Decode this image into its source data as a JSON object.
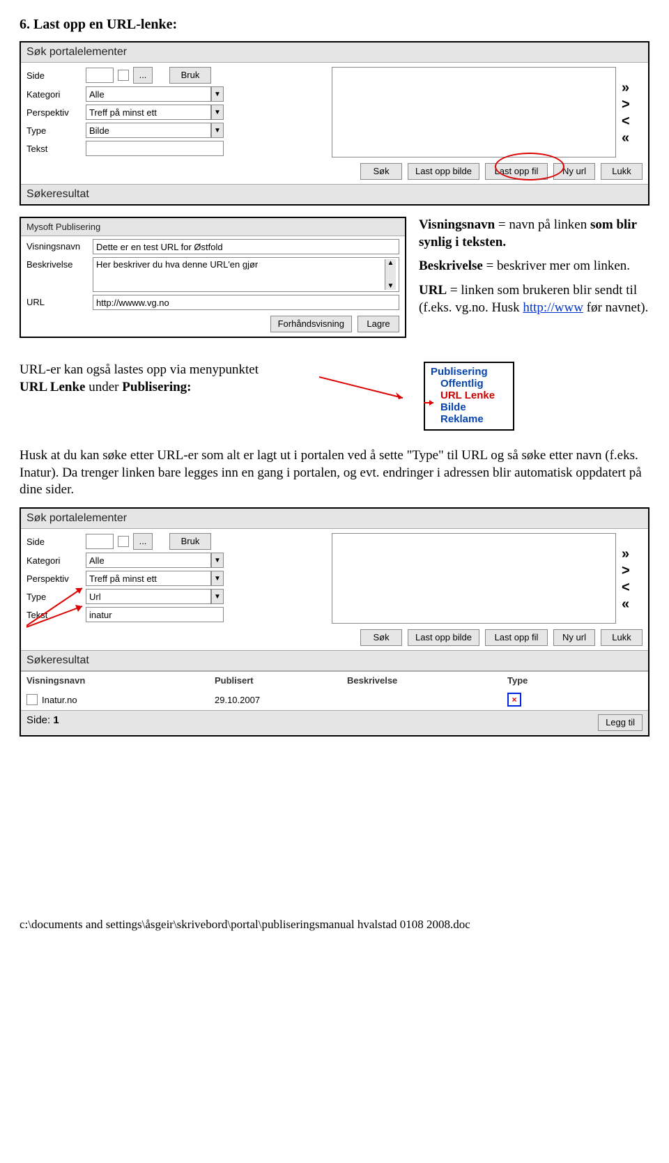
{
  "heading": "6. Last opp en URL-lenke:",
  "panel1": {
    "title": "Søk portalelementer",
    "labels": {
      "side": "Side",
      "kategori": "Kategori",
      "perspektiv": "Perspektiv",
      "type": "Type",
      "tekst": "Tekst"
    },
    "side_value": "",
    "side_btn": "...",
    "bruk_btn": "Bruk",
    "kategori_value": "Alle",
    "perspektiv_value": "Treff på minst ett",
    "type_value": "Bilde",
    "tekst_value": "",
    "buttons": {
      "sok": "Søk",
      "last_bilde": "Last opp bilde",
      "last_fil": "Last opp fil",
      "ny_url": "Ny url",
      "lukk": "Lukk"
    },
    "result_title": "Søkeresultat"
  },
  "arrows": {
    "dright": "»",
    "right": ">",
    "left": "<",
    "dleft": "«"
  },
  "pubform": {
    "title": "Mysoft Publisering",
    "labels": {
      "visningsnavn": "Visningsnavn",
      "beskrivelse": "Beskrivelse",
      "url": "URL"
    },
    "visningsnavn_value": "Dette er en test URL for Østfold",
    "beskrivelse_value": "Her beskriver du hva denne URL'en gjør",
    "url_value": "http://wwww.vg.no",
    "buttons": {
      "forh": "Forhåndsvisning",
      "lagre": "Lagre"
    }
  },
  "sidetext": {
    "l1a": "Visningsnavn",
    "l1b": " = navn på linken ",
    "l1c": "som blir synlig i teksten.",
    "l2a": "Beskrivelse",
    "l2b": " = beskriver mer om linken.",
    "l3a": "URL",
    "l3b": " = linken som brukeren blir sendt til (f.eks. vg.no. Husk ",
    "l3c": "http://www",
    "l3d": " før navnet)."
  },
  "urltext": {
    "a": "URL-er kan også lastes opp via menypunktet",
    "b": "URL Lenke under Publisering:"
  },
  "menu": {
    "title": "Publisering",
    "offentlig": "Offentlig",
    "urllenke": "URL Lenke",
    "bilde": "Bilde",
    "reklame": "Reklame"
  },
  "para2": "Husk at du kan søke etter URL-er som alt er lagt ut i portalen ved å sette \"Type\" til URL og så søke etter navn (f.eks. Inatur). Da trenger linken bare legges inn en gang i portalen, og evt. endringer i adressen blir automatisk oppdatert på dine sider.",
  "panel3": {
    "title": "Søk portalelementer",
    "type_value": "Url",
    "tekst_value": "inatur",
    "result_title": "Søkeresultat",
    "cols": {
      "c1": "Visningsnavn",
      "c2": "Publisert",
      "c3": "Beskrivelse",
      "c4": "Type"
    },
    "row": {
      "name": "Inatur.no",
      "date": "29.10.2007"
    },
    "side_lbl": "Side:",
    "side_n": "1",
    "legg_til": "Legg til"
  },
  "footer": "c:\\documents and settings\\åsgeir\\skrivebord\\portal\\publiseringsmanual hvalstad 0108 2008.doc"
}
